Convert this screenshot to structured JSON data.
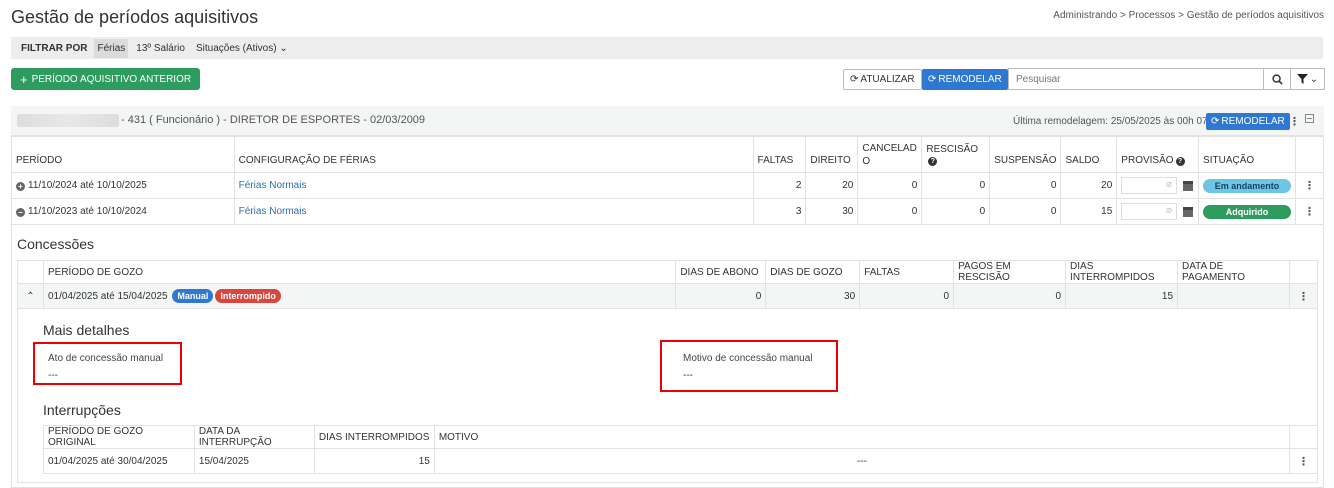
{
  "header": {
    "title": "Gestão de períodos aquisitivos",
    "breadcrumb": "Administrando > Processos > Gestão de períodos aquisitivos"
  },
  "filter": {
    "label": "FILTRAR POR",
    "options": [
      "Férias",
      "13º Salário",
      "Situações (Ativos)"
    ]
  },
  "toolbar": {
    "add_label": "PERÍODO AQUISITIVO ANTERIOR",
    "refresh_label": "ATUALIZAR",
    "remodel_label": "REMODELAR",
    "search_placeholder": "Pesquisar"
  },
  "employee": {
    "info": "- 431 ( Funcionário ) - DIRETOR DE ESPORTES - 02/03/2009",
    "last_remodel": "Última remodelagem: 25/05/2025 às 00h 07m",
    "remodel_label": "REMODELAR"
  },
  "periods": {
    "columns": [
      "PERÍODO",
      "CONFIGURAÇÃO DE FÉRIAS",
      "FALTAS",
      "DIREITO",
      "CANCELAD O",
      "RESCISÃO",
      "SUSPENSÃO",
      "SALDO",
      "PROVISÃO",
      "SITUAÇÃO"
    ],
    "rows": [
      {
        "period": "11/10/2024 até 10/10/2025",
        "config": "Férias Normais",
        "faltas": "2",
        "direito": "20",
        "cancelado": "0",
        "rescisao": "0",
        "suspensao": "0",
        "saldo": "20",
        "situacao": "Em andamento"
      },
      {
        "period": "11/10/2023 até 10/10/2024",
        "config": "Férias Normais",
        "faltas": "3",
        "direito": "30",
        "cancelado": "0",
        "rescisao": "0",
        "suspensao": "0",
        "saldo": "15",
        "situacao": "Adquirido"
      }
    ]
  },
  "concessoes": {
    "title": "Concessões",
    "columns": [
      "PERÍODO DE GOZO",
      "DIAS DE ABONO",
      "DIAS DE GOZO",
      "FALTAS",
      "PAGOS EM RESCISÃO",
      "DIAS INTERROMPIDOS",
      "DATA DE PAGAMENTO"
    ],
    "row": {
      "period": "01/04/2025 até 15/04/2025",
      "tag_manual": "Manual",
      "tag_interrompido": "Interrompido",
      "abono": "0",
      "gozo": "30",
      "faltas": "0",
      "pagos": "0",
      "interrompidos": "15",
      "pagamento": ""
    }
  },
  "detalhes": {
    "title": "Mais detalhes",
    "ato_label": "Ato de concessão manual",
    "ato_value": "---",
    "motivo_label": "Motivo de concessão manual",
    "motivo_value": "---"
  },
  "interrupcoes": {
    "title": "Interrupções",
    "columns": [
      "PERÍODO DE GOZO ORIGINAL",
      "DATA DA INTERRUPÇÃO",
      "DIAS INTERROMPIDOS",
      "MOTIVO"
    ],
    "row": {
      "original": "01/04/2025 até 30/04/2025",
      "data": "15/04/2025",
      "dias": "15",
      "motivo": "---"
    }
  },
  "colors": {
    "green": "#2e9b5f",
    "blue": "#2f78d2",
    "red": "#d9463e",
    "highlight": "#e00000"
  }
}
